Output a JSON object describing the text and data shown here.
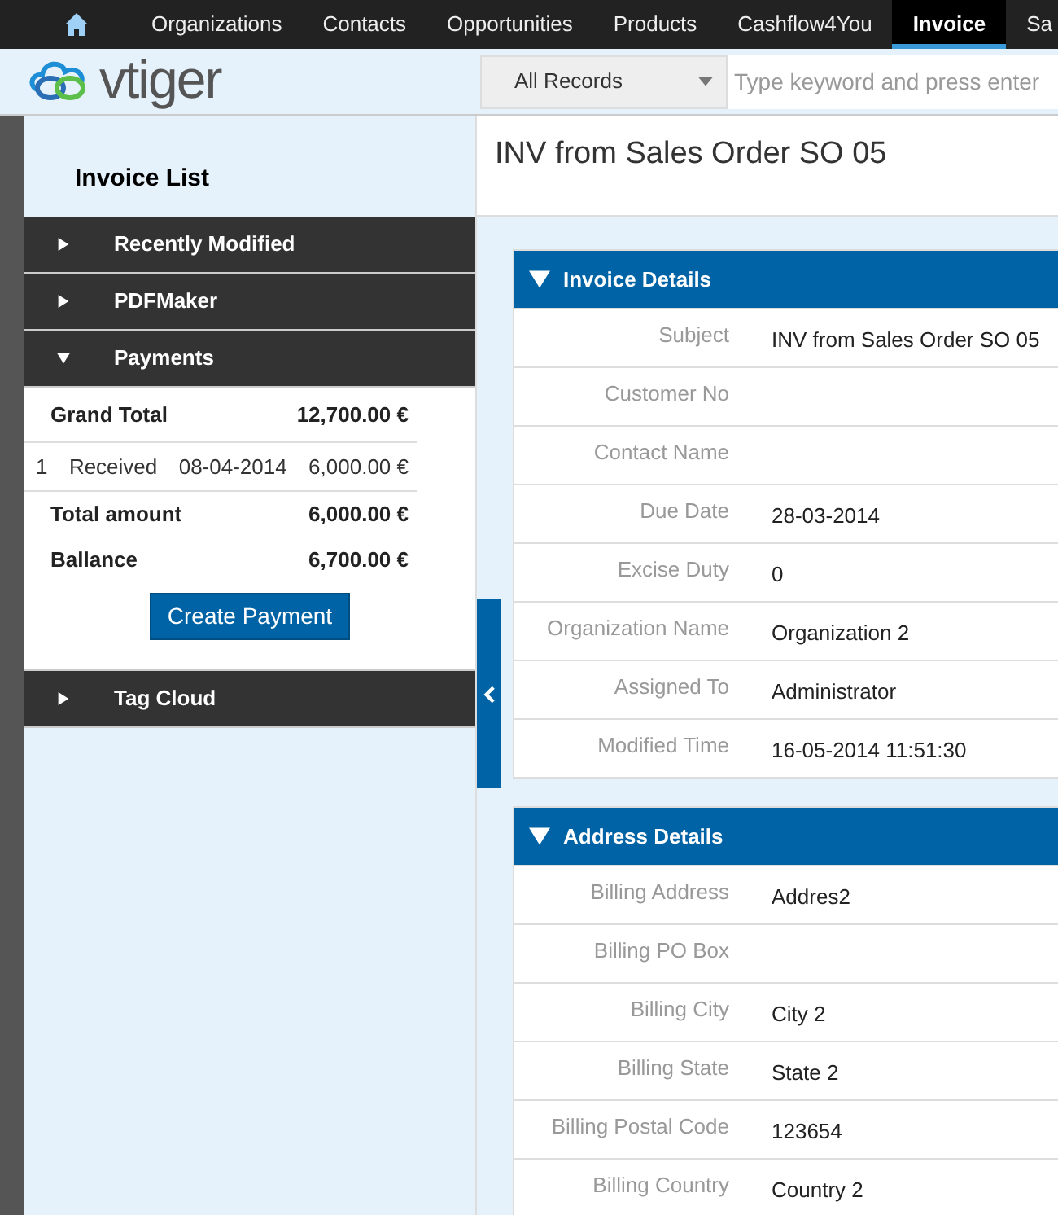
{
  "nav": {
    "items": [
      {
        "label": "Organizations",
        "selected": false
      },
      {
        "label": "Contacts",
        "selected": false
      },
      {
        "label": "Opportunities",
        "selected": false
      },
      {
        "label": "Products",
        "selected": false
      },
      {
        "label": "Cashflow4You",
        "selected": false
      },
      {
        "label": "Invoice",
        "selected": true
      },
      {
        "label": "Sa",
        "selected": false
      }
    ]
  },
  "header": {
    "logo_text": "vtiger",
    "filter": "All Records",
    "search": {
      "placeholder": "Type keyword and press enter"
    }
  },
  "sidebar": {
    "title": "Invoice List",
    "sections": [
      {
        "label": "Recently Modified",
        "expanded": false
      },
      {
        "label": "PDFMaker",
        "expanded": false
      },
      {
        "label": "Payments",
        "expanded": true,
        "payments": {
          "grand_total": {
            "label": "Grand Total",
            "value": "12,700.00 €"
          },
          "rows": [
            {
              "number": "1",
              "status": "Received",
              "date": "08-04-2014",
              "amount": "6,000.00 €"
            }
          ],
          "totals": [
            {
              "label": "Total amount",
              "value": "6,000.00 €"
            },
            {
              "label": "Ballance",
              "value": "6,700.00 €"
            }
          ],
          "button": "Create Payment"
        }
      },
      {
        "label": "Tag Cloud",
        "expanded": false
      }
    ]
  },
  "record": {
    "title": "INV from Sales Order SO 05",
    "blocks": [
      {
        "title": "Invoice Details",
        "expanded": true,
        "fields": [
          {
            "label": "Subject",
            "value": "INV from Sales Order SO 05"
          },
          {
            "label": "Customer No"
          },
          {
            "label": "Contact Name"
          },
          {
            "label": "Due Date",
            "value": "28-03-2014"
          },
          {
            "label": "Excise Duty",
            "value": "0"
          },
          {
            "label": "Organization Name",
            "value": "Organization 2"
          },
          {
            "label": "Assigned To",
            "value": "Administrator"
          },
          {
            "label": "Modified Time",
            "value": "16-05-2014 11:51:30"
          }
        ]
      },
      {
        "title": "Address Details",
        "expanded": true,
        "fields": [
          {
            "label": "Billing Address",
            "value": "Addres2"
          },
          {
            "label": "Billing PO Box"
          },
          {
            "label": "Billing City",
            "value": "City 2"
          },
          {
            "label": "Billing State",
            "value": "State 2"
          },
          {
            "label": "Billing Postal Code",
            "value": "123654"
          },
          {
            "label": "Billing Country",
            "value": "Country 2"
          }
        ]
      }
    ]
  }
}
